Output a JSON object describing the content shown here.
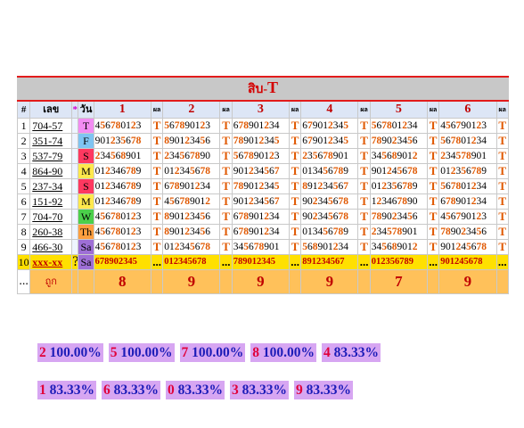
{
  "title": "สิบ-",
  "title_mark": "T",
  "columns": {
    "index": "#",
    "code": "เลข",
    "star": "*",
    "day": "วัน",
    "sub": "ผล",
    "digits": [
      "1",
      "2",
      "3",
      "4",
      "5",
      "6"
    ]
  },
  "colors": {
    "title_bg": "#c8c8c8",
    "hit": "#e05800",
    "last_row": "#ffe000",
    "summary": "#ffc15a",
    "stats_bg": "#d7a6f2"
  },
  "rows": [
    {
      "n": "1",
      "code": "704-57",
      "day": "T",
      "day_color": "#f28cf2",
      "seqs": [
        "456780123",
        "567890123",
        "678901234",
        "679012345",
        "567801234",
        "456790123"
      ],
      "res": [
        "T",
        "T",
        "T",
        "T",
        "T",
        "T"
      ]
    },
    {
      "n": "2",
      "code": "351-74",
      "day": "F",
      "day_color": "#7fc4f2",
      "seqs": [
        "901235678",
        "890123456",
        "789012345",
        "679012345",
        "789023456",
        "567801234"
      ],
      "res": [
        "T",
        "T",
        "T",
        "T",
        "T",
        "T"
      ]
    },
    {
      "n": "3",
      "code": "537-79",
      "day": "S",
      "day_color": "#ff3860",
      "seqs": [
        "234568901",
        "234567890",
        "567890123",
        "235678901",
        "345689012",
        "234578901"
      ],
      "res": [
        "T",
        "T",
        "T",
        "T",
        "T",
        "T"
      ]
    },
    {
      "n": "4",
      "code": "864-90",
      "day": "M",
      "day_color": "#ffe94d",
      "seqs": [
        "012346789",
        "012345678",
        "901234567",
        "013456789",
        "901245678",
        "012356789"
      ],
      "res": [
        "T",
        "T",
        "T",
        "T",
        "T",
        "T"
      ]
    },
    {
      "n": "5",
      "code": "237-34",
      "day": "S",
      "day_color": "#ff3860",
      "seqs": [
        "012346789",
        "678901234",
        "789012345",
        "891234567",
        "012356789",
        "567801234"
      ],
      "res": [
        "T",
        "T",
        "T",
        "T",
        "T",
        "T"
      ]
    },
    {
      "n": "6",
      "code": "151-92",
      "day": "M",
      "day_color": "#ffe94d",
      "seqs": [
        "012346789",
        "456789012",
        "901234567",
        "902345678",
        "123467890",
        "678901234"
      ],
      "res": [
        "T",
        "T",
        "T",
        "T",
        "T",
        "T"
      ]
    },
    {
      "n": "7",
      "code": "704-70",
      "day": "W",
      "day_color": "#4bd04b",
      "seqs": [
        "456780123",
        "890123456",
        "678901234",
        "902345678",
        "789023456",
        "456790123"
      ],
      "res": [
        "T",
        "T",
        "T",
        "T",
        "T",
        "T"
      ]
    },
    {
      "n": "8",
      "code": "260-38",
      "day": "Th",
      "day_color": "#ff9f3f",
      "seqs": [
        "456780123",
        "890123456",
        "678901234",
        "013456789",
        "234578901",
        "789023456"
      ],
      "res": [
        "T",
        "T",
        "T",
        "T",
        "T",
        "T"
      ]
    },
    {
      "n": "9",
      "code": "466-30",
      "day": "Sa",
      "day_color": "#9e6fd6",
      "seqs": [
        "456780123",
        "012345678",
        "345678901",
        "568901234",
        "345689012",
        "901245678"
      ],
      "res": [
        "T",
        "T",
        "T",
        "T",
        "T",
        "T"
      ]
    }
  ],
  "last_row": {
    "n": "10",
    "code": "xxx-xx",
    "star": "?",
    "day": "Sa",
    "day_color": "#9e6fd6",
    "seqs": [
      "678902345",
      "012345678",
      "789012345",
      "891234567",
      "012356789",
      "901245678"
    ],
    "res": [
      "...",
      "...",
      "...",
      "...",
      "...",
      "..."
    ]
  },
  "summary": {
    "dots": "...",
    "label": "ถูก",
    "counts": [
      "8",
      "9",
      "9",
      "9",
      "7",
      "9"
    ]
  },
  "stats": [
    [
      {
        "digit": "2",
        "pct": "100.00%"
      },
      {
        "digit": "5",
        "pct": "100.00%"
      },
      {
        "digit": "7",
        "pct": "100.00%"
      },
      {
        "digit": "8",
        "pct": "100.00%"
      },
      {
        "digit": "4",
        "pct": "83.33%"
      }
    ],
    [
      {
        "digit": "1",
        "pct": "83.33%"
      },
      {
        "digit": "6",
        "pct": "83.33%"
      },
      {
        "digit": "0",
        "pct": "83.33%"
      },
      {
        "digit": "3",
        "pct": "83.33%"
      },
      {
        "digit": "9",
        "pct": "83.33%"
      }
    ]
  ]
}
